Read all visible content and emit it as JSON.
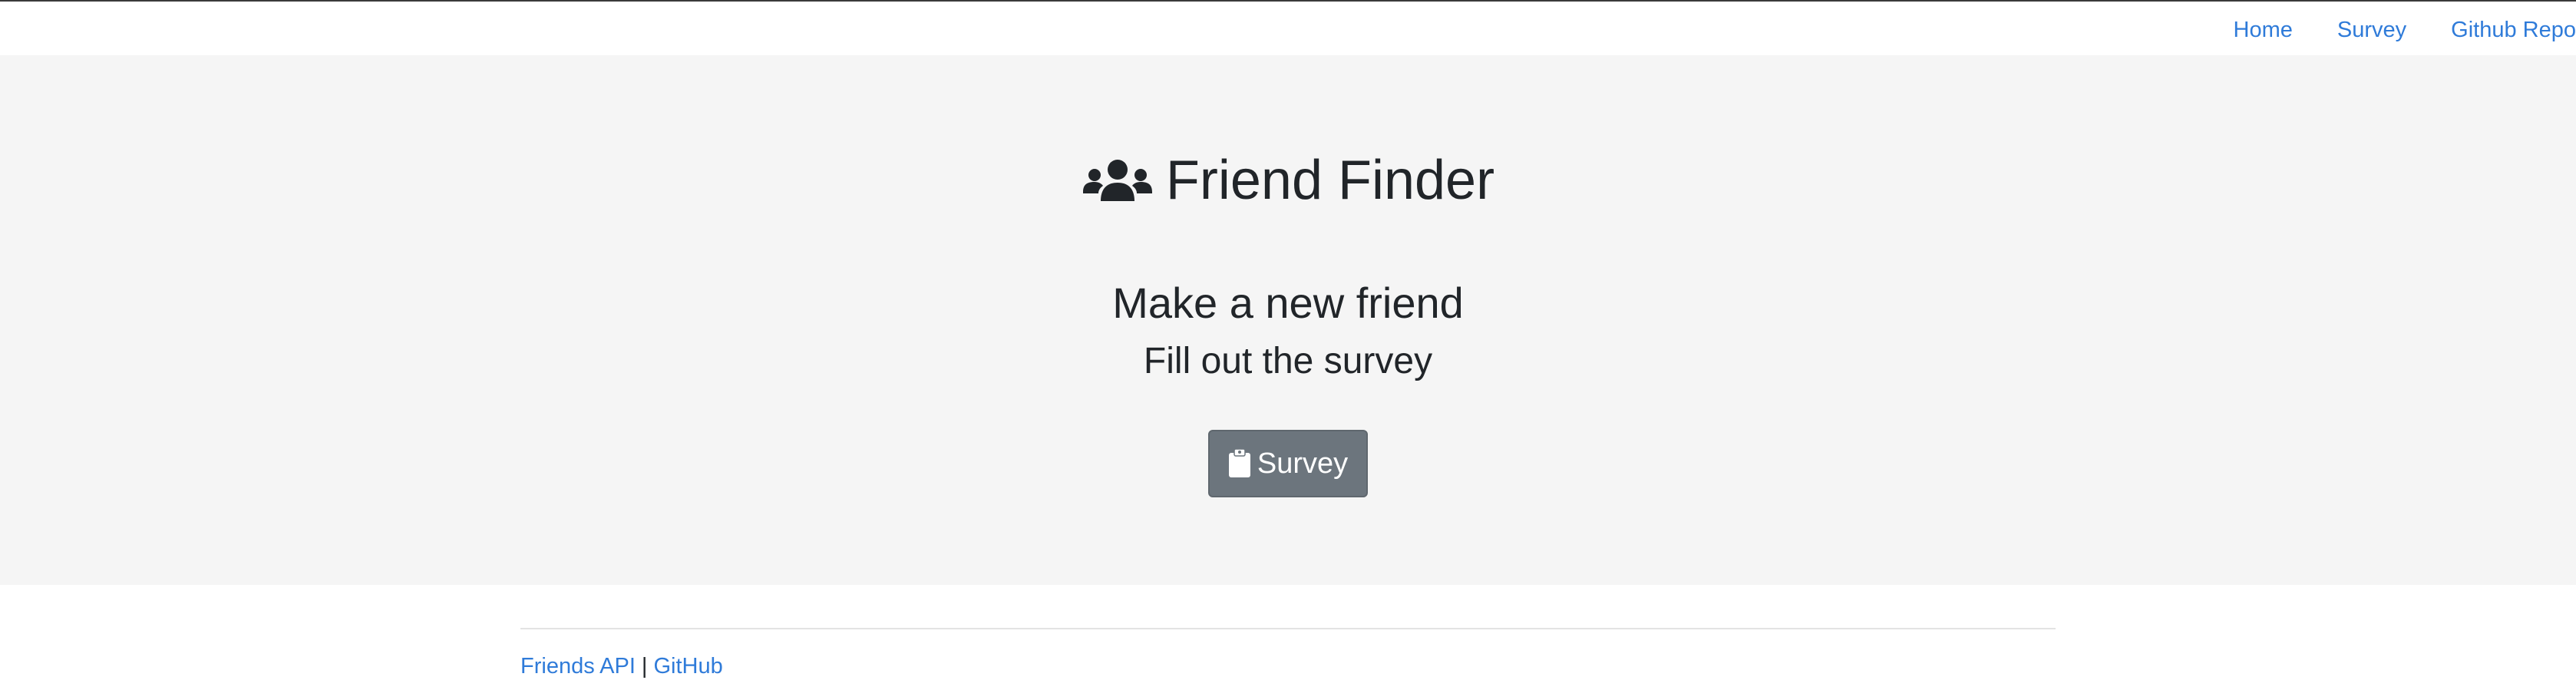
{
  "nav": {
    "home": "Home",
    "survey": "Survey",
    "repo": "Github Repo"
  },
  "hero": {
    "title": "Friend Finder",
    "title_icon": "users-icon",
    "subtitle": "Make a new friend",
    "subtitle2": "Fill out the survey",
    "button_label": "Survey",
    "button_icon": "clipboard-icon"
  },
  "footer": {
    "api_link": "Friends API",
    "separator": "|",
    "github_link": "GitHub"
  },
  "colors": {
    "link": "#2f7bd9",
    "hero_bg": "#f5f5f5",
    "button_bg": "#6c757d",
    "text": "#212529"
  }
}
